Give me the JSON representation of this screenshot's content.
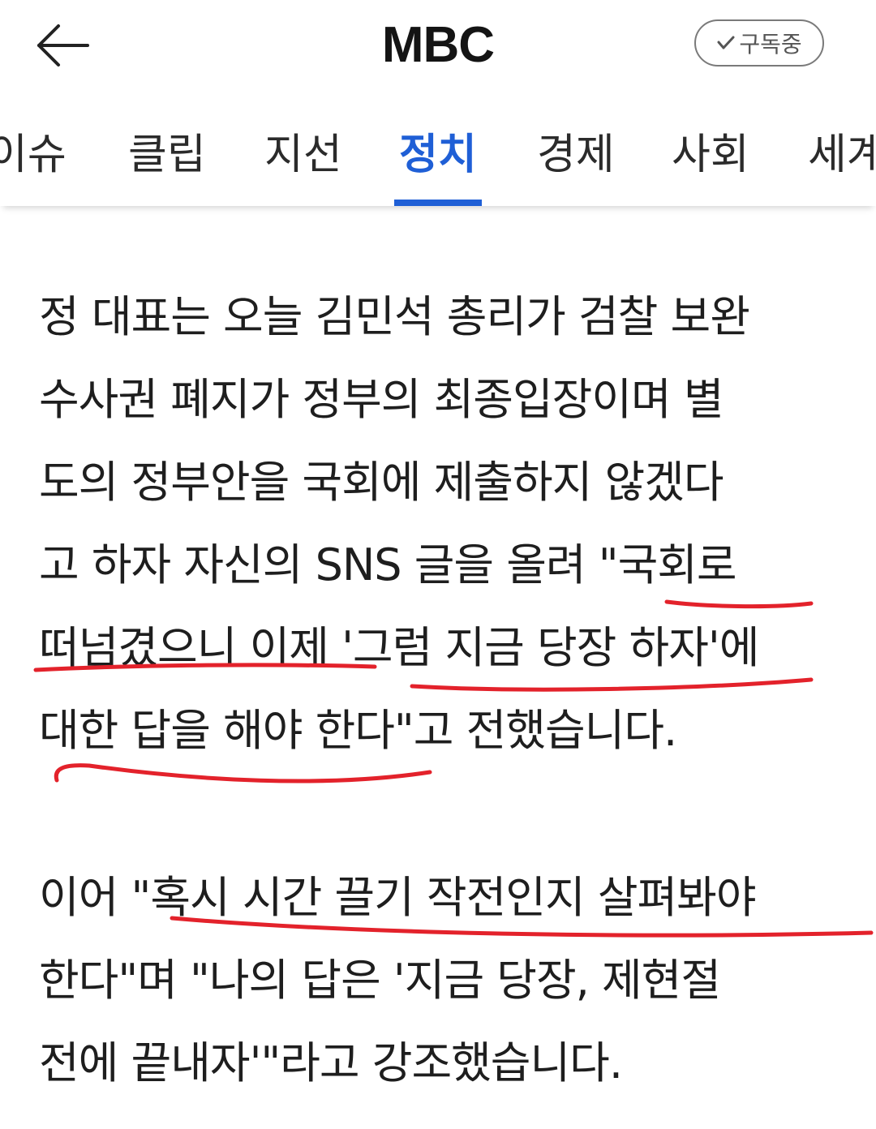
{
  "header": {
    "back_icon": "arrow-left-icon",
    "title": "MBC",
    "subscribe_label": "구독중",
    "subscribe_icon": "check-icon"
  },
  "tabs": [
    {
      "label": "이슈"
    },
    {
      "label": "클립"
    },
    {
      "label": "지선"
    },
    {
      "label": "정치",
      "active": true
    },
    {
      "label": "경제"
    },
    {
      "label": "사회"
    },
    {
      "label": "세계"
    }
  ],
  "article": {
    "paragraph1_lines": [
      "정 대표는 오늘 김민석 총리가 검찰 보완",
      "수사권 폐지가 정부의 최종입장이며 별",
      "도의 정부안을 국회에 제출하지 않겠다",
      "고 하자 자신의 SNS 글을 올려 \"국회로",
      "떠넘겼으니 이제 '그럼 지금 당장 하자'에",
      "대한 답을 해야 한다\"고 전했습니다."
    ],
    "paragraph2_lines": [
      "이어 \"혹시 시간 끌기 작전인지 살펴봐야",
      "한다\"며 \"나의 답은 '지금 당장, 제현절",
      "전에 끝내자'\"라고 강조했습니다."
    ]
  },
  "colors": {
    "accent": "#1f5fd6",
    "annotation": "#e3222b"
  }
}
